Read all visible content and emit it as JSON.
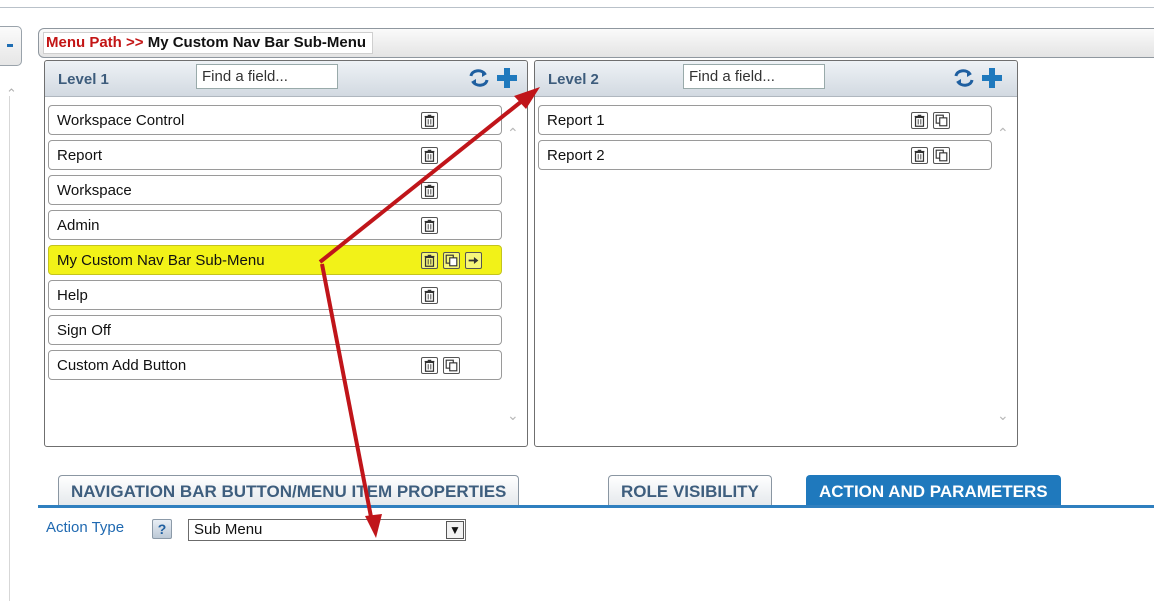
{
  "menu_path": {
    "label": "Menu Path >>",
    "value": "My Custom Nav Bar Sub-Menu"
  },
  "level1": {
    "title": "Level 1",
    "search_placeholder": "Find a field...",
    "items": [
      {
        "label": "Workspace Control",
        "buttons": [
          "trash-icon"
        ]
      },
      {
        "label": "Report",
        "buttons": [
          "trash-icon"
        ]
      },
      {
        "label": "Workspace",
        "buttons": [
          "trash-icon"
        ]
      },
      {
        "label": "Admin",
        "buttons": [
          "trash-icon"
        ]
      },
      {
        "label": "My Custom Nav Bar Sub-Menu",
        "buttons": [
          "trash-icon",
          "copy-icon",
          "drill-in-icon"
        ],
        "selected": true
      },
      {
        "label": "Help",
        "buttons": [
          "trash-icon"
        ]
      },
      {
        "label": "Sign Off",
        "buttons": []
      },
      {
        "label": "Custom Add Button",
        "buttons": [
          "trash-icon",
          "copy-icon"
        ]
      }
    ]
  },
  "level2": {
    "title": "Level 2",
    "search_placeholder": "Find a field...",
    "items": [
      {
        "label": "Report 1",
        "buttons": [
          "trash-icon",
          "copy-icon"
        ]
      },
      {
        "label": "Report 2",
        "buttons": [
          "trash-icon",
          "copy-icon"
        ]
      }
    ]
  },
  "tabs": [
    {
      "label": "NAVIGATION BAR BUTTON/MENU ITEM PROPERTIES",
      "active": false
    },
    {
      "label": "ROLE VISIBILITY",
      "active": false
    },
    {
      "label": "ACTION AND PARAMETERS",
      "active": true
    }
  ],
  "action": {
    "label": "Action Type",
    "help": "?",
    "value": "Sub Menu"
  },
  "colors": {
    "accent": "#1f79bd",
    "selected_row": "#f2f218",
    "menu_path_label": "#c31515",
    "annotation_arrow": "#c0151a"
  }
}
